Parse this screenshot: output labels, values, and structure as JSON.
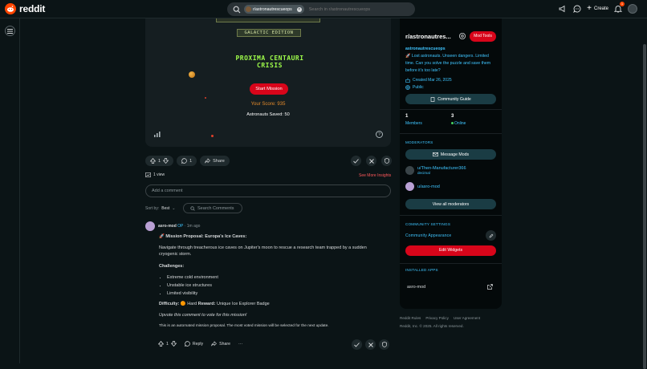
{
  "header": {
    "logo_text": "reddit",
    "search": {
      "chip_label": "r/astronautrescueops",
      "placeholder": "Search in r/astronautrescueops"
    },
    "create_label": "Create",
    "notification_count": "1"
  },
  "game": {
    "edition_label": "GALACTIC EDITION",
    "title_line1": "PROXIMA CENTAURI",
    "title_line2": "CRISIS",
    "start_button": "Start Mission",
    "score_text": "Your Score: 935",
    "saved_text": "Astronauts Saved: 50",
    "help_glyph": "?"
  },
  "post_actions": {
    "vote_count": "1",
    "comment_count": "1",
    "share_label": "Share"
  },
  "views_text": "1 view",
  "insights_link": "See More Insights",
  "add_comment_placeholder": "Add a comment",
  "sort": {
    "label": "Sort by:",
    "value": "Best"
  },
  "search_comments_label": "Search Comments",
  "comment": {
    "author": "asro-mod",
    "badge": "OP",
    "time": "1m ago",
    "title": "🚀 Mission Proposal: Europa's Ice Caves:",
    "description": "Navigate through treacherous ice caves on Jupiter's moon to rescue a research team trapped by a sudden cryogenic storm.",
    "challenges_label": "Challenges:",
    "challenges": [
      "Extreme cold environment",
      "Unstable ice structures",
      "Limited visibility"
    ],
    "difficulty_label": "Difficulty:",
    "difficulty_value": "🟠 Hard",
    "reward_label": "Reward:",
    "reward_value": "Unique Ice Explorer Badge",
    "vote_prompt": "Upvote this comment to vote for this mission!",
    "automated_note": "This is an automated mission proposal. The most voted mission will be selected for the next update.",
    "vote_count": "1",
    "reply_label": "Reply",
    "share_label": "Share",
    "more_label": "···"
  },
  "sidebar": {
    "title": "r/astronautres...",
    "mod_tools": "Mod Tools",
    "community_name": "astronautrescueops",
    "description": "🚀 Lost astronauts. Unseen dangers. Limited time. Can you solve the puzzle and save them before it's too late?",
    "created": "Created Mar 26, 2025",
    "visibility": "Public",
    "guide_button": "Community Guide",
    "members_count": "1",
    "members_label": "Members",
    "online_count": "3",
    "online_label": "Online",
    "moderators_heading": "MODERATORS",
    "message_mods": "Message Mods",
    "moderators": [
      {
        "name": "u/Then-Manufacturer366",
        "flair": "decimal"
      },
      {
        "name": "u/asro-mod",
        "flair": ""
      }
    ],
    "view_all_mods": "View all moderators",
    "settings_heading": "COMMUNITY SETTINGS",
    "appearance_label": "Community Appearance",
    "edit_widgets": "Edit Widgets",
    "installed_heading": "INSTALLED APPS",
    "app_name": "asro-mod"
  },
  "footer": {
    "links": [
      "Reddit Rules",
      "Privacy Policy",
      "User Agreement"
    ],
    "copyright": "Reddit, Inc. © 2025. All rights reserved."
  },
  "colors": {
    "brand": "#ff4500",
    "accent_red": "#d8051a",
    "link_blue": "#3fc5ff",
    "game_green": "#9efc4a",
    "score_orange": "#e48a2a"
  }
}
